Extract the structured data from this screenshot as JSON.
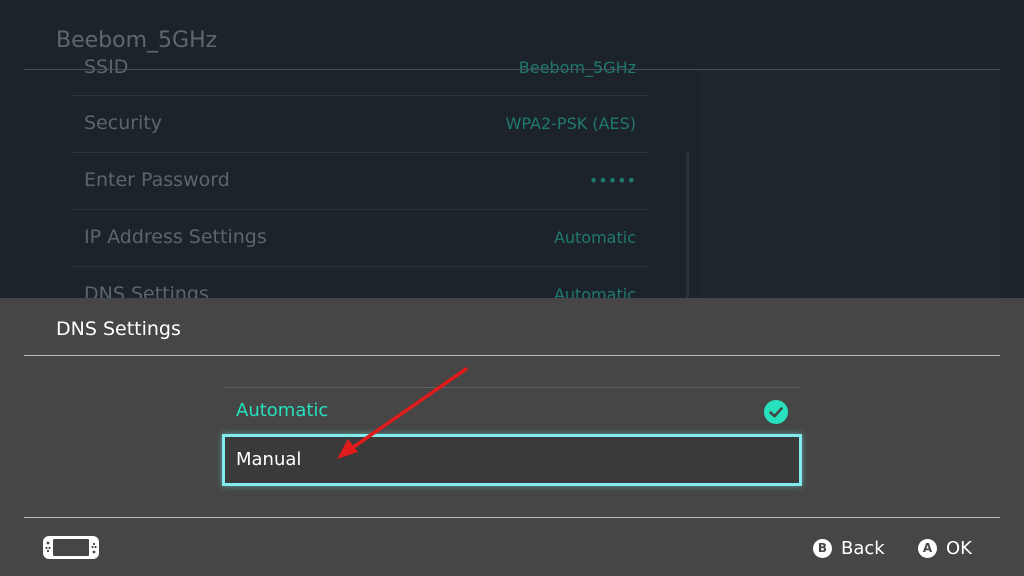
{
  "background": {
    "title": "Beebom_5GHz",
    "rows": [
      {
        "label": "SSID",
        "value": "Beebom_5GHz"
      },
      {
        "label": "Security",
        "value": "WPA2-PSK (AES)"
      },
      {
        "label": "Enter Password",
        "value": "•••••"
      },
      {
        "label": "IP Address Settings",
        "value": "Automatic"
      },
      {
        "label": "DNS Settings",
        "value": "Automatic"
      }
    ]
  },
  "dialog": {
    "title": "DNS Settings",
    "options": [
      {
        "label": "Automatic",
        "selected": true
      },
      {
        "label": "Manual",
        "focused": true
      }
    ]
  },
  "footer": {
    "back_glyph": "B",
    "back_label": "Back",
    "ok_glyph": "A",
    "ok_label": "OK",
    "console_icon": "handheld-console-icon"
  },
  "colors": {
    "accent": "#27e0bd",
    "focus": "#82ecef",
    "annotation_arrow": "#e01b1b"
  }
}
